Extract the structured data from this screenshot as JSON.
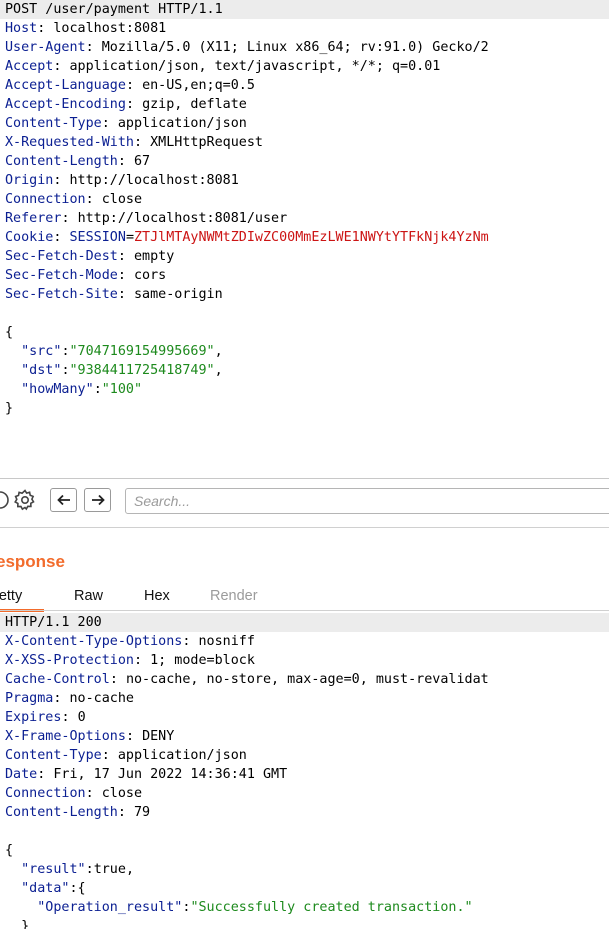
{
  "request": {
    "start_line": "POST /user/payment HTTP/1.1",
    "headers": [
      {
        "name": "Host",
        "value": "localhost:8081"
      },
      {
        "name": "User-Agent",
        "value": "Mozilla/5.0 (X11; Linux x86_64; rv:91.0) Gecko/2"
      },
      {
        "name": "Accept",
        "value": "application/json, text/javascript, */*; q=0.01"
      },
      {
        "name": "Accept-Language",
        "value": "en-US,en;q=0.5"
      },
      {
        "name": "Accept-Encoding",
        "value": "gzip, deflate"
      },
      {
        "name": "Content-Type",
        "value": "application/json"
      },
      {
        "name": "X-Requested-With",
        "value": "XMLHttpRequest"
      },
      {
        "name": "Content-Length",
        "value": "67"
      },
      {
        "name": "Origin",
        "value": "http://localhost:8081"
      },
      {
        "name": "Connection",
        "value": "close"
      },
      {
        "name": "Referer",
        "value": "http://localhost:8081/user"
      }
    ],
    "cookie": {
      "name": "Cookie",
      "cookie_name": "SESSION",
      "cookie_value": "ZTJlMTAyNWMtZDIwZC00MmEzLWE1NWYtYTFkNjk4YzNm"
    },
    "headers_after": [
      {
        "name": "Sec-Fetch-Dest",
        "value": "empty"
      },
      {
        "name": "Sec-Fetch-Mode",
        "value": "cors"
      },
      {
        "name": "Sec-Fetch-Site",
        "value": "same-origin"
      }
    ],
    "body": {
      "open": "{",
      "fields": [
        {
          "key": "\"src\"",
          "value": "\"7047169154995669\"",
          "sep": ","
        },
        {
          "key": "\"dst\"",
          "value": "\"9384411725418749\"",
          "sep": ","
        },
        {
          "key": "\"howMany\"",
          "value": "\"100\"",
          "sep": ""
        }
      ],
      "close": "}"
    }
  },
  "search": {
    "placeholder": "Search..."
  },
  "response": {
    "title": "esponse",
    "tabs": {
      "pretty": "retty",
      "raw": "Raw",
      "hex": "Hex",
      "render": "Render"
    },
    "status_line": "HTTP/1.1 200",
    "headers": [
      {
        "name": "X-Content-Type-Options",
        "value": "nosniff"
      },
      {
        "name": "X-XSS-Protection",
        "value": "1; mode=block"
      },
      {
        "name": "Cache-Control",
        "value": "no-cache, no-store, max-age=0, must-revalidat"
      },
      {
        "name": "Pragma",
        "value": "no-cache"
      },
      {
        "name": "Expires",
        "value": "0"
      },
      {
        "name": "X-Frame-Options",
        "value": "DENY"
      },
      {
        "name": "Content-Type",
        "value": "application/json"
      },
      {
        "name": "Date",
        "value": "Fri, 17 Jun 2022 14:36:41 GMT"
      },
      {
        "name": "Connection",
        "value": "close"
      },
      {
        "name": "Content-Length",
        "value": "79"
      }
    ],
    "body": {
      "open": "{",
      "result_key": "\"result\"",
      "result_value": "true",
      "data_key": "\"data\"",
      "op_key": "\"Operation_result\"",
      "op_value": "\"Successfully created transaction.\"",
      "inner_close": "}"
    }
  },
  "colors": {
    "accent": "#f26b2b",
    "header_key": "#0b1f92",
    "cookie_value": "#cc1414",
    "json_string": "#1d8a1d"
  }
}
